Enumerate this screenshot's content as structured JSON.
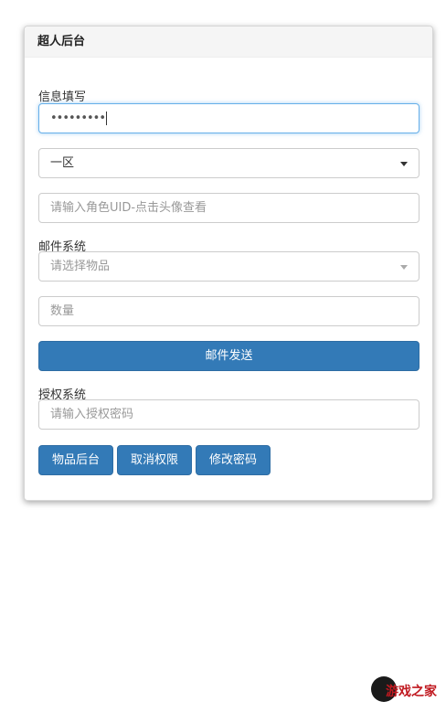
{
  "panel": {
    "title": "超人后台"
  },
  "info_section": {
    "label": "信息填写",
    "password_value": "•••••••••",
    "region_selected": "一区",
    "uid_placeholder": "请输入角色UID-点击头像查看"
  },
  "mail_section": {
    "label": "邮件系统",
    "item_placeholder": "请选择物品",
    "quantity_placeholder": "数量",
    "send_label": "邮件发送"
  },
  "auth_section": {
    "label": "授权系统",
    "password_placeholder": "请输入授权密码",
    "buttons": {
      "items_admin": "物品后台",
      "revoke": "取消权限",
      "change_password": "修改密码"
    }
  },
  "watermark": {
    "text": "游戏之家"
  },
  "colors": {
    "primary": "#337ab7",
    "focus_border": "#66afe9"
  }
}
